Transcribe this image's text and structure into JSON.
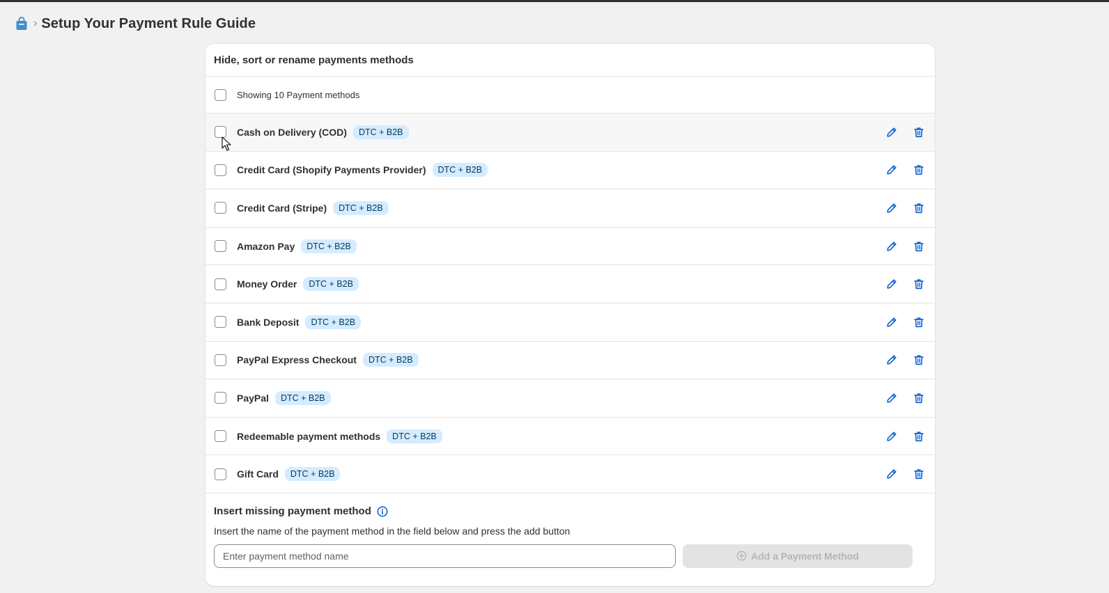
{
  "breadcrumb": {
    "app_icon": "shopping-bag-icon",
    "separator": "›",
    "title": "Setup Your Payment Rule Guide"
  },
  "card": {
    "title": "Hide, sort or rename payments methods",
    "select_all_label": "Showing 10 Payment methods"
  },
  "methods": [
    {
      "name": "Cash on Delivery (COD)",
      "badge": "DTC + B2B"
    },
    {
      "name": "Credit Card (Shopify Payments Provider)",
      "badge": "DTC + B2B"
    },
    {
      "name": "Credit Card (Stripe)",
      "badge": "DTC + B2B"
    },
    {
      "name": "Amazon Pay",
      "badge": "DTC + B2B"
    },
    {
      "name": "Money Order",
      "badge": "DTC + B2B"
    },
    {
      "name": "Bank Deposit",
      "badge": "DTC + B2B"
    },
    {
      "name": "PayPal Express Checkout",
      "badge": "DTC + B2B"
    },
    {
      "name": "PayPal",
      "badge": "DTC + B2B"
    },
    {
      "name": "Redeemable payment methods",
      "badge": "DTC + B2B"
    },
    {
      "name": "Gift Card",
      "badge": "DTC + B2B"
    }
  ],
  "row_icons": {
    "edit": "pencil-icon",
    "delete": "trash-icon"
  },
  "insert": {
    "title": "Insert missing payment method",
    "info_icon": "info-icon",
    "help": "Insert the name of the payment method in the field below and press the add button",
    "placeholder": "Enter payment method name",
    "value": "",
    "button_label": "Add a Payment Method",
    "button_icon": "plus-circle-icon"
  },
  "colors": {
    "accent": "#005bd3",
    "badge_bg": "#d5ebff",
    "badge_text": "#003a5a",
    "disabled_button_bg": "#e3e3e3",
    "disabled_button_text": "#b5b5b5"
  }
}
